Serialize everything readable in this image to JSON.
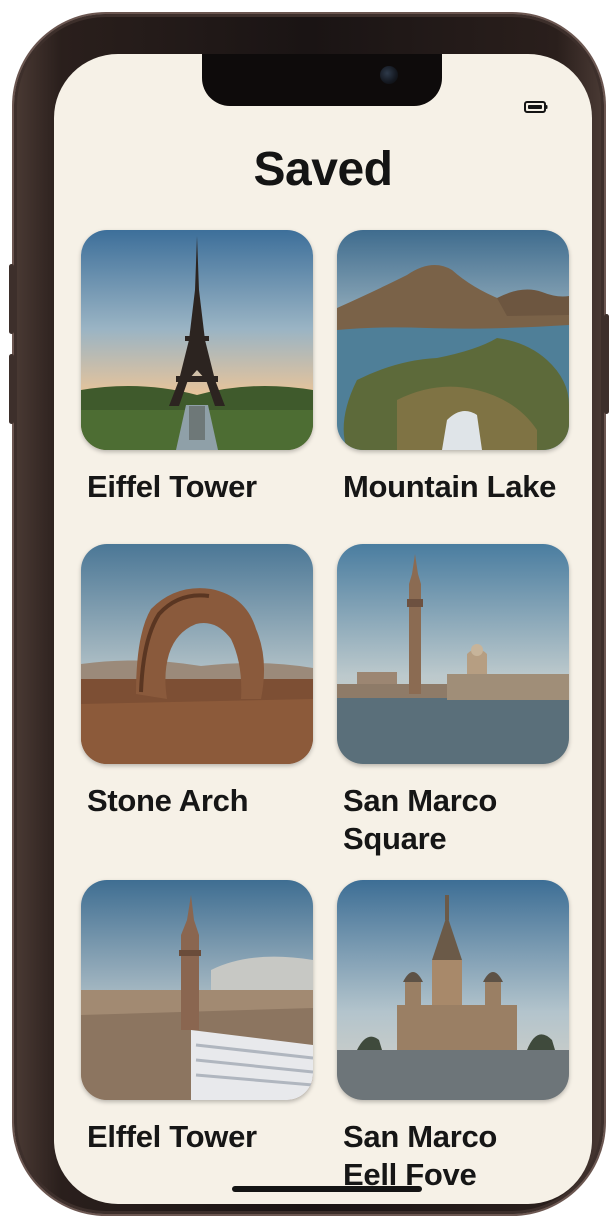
{
  "screen": {
    "title": "Saved"
  },
  "status_bar": {
    "icon": "battery-icon"
  },
  "saved_items": [
    {
      "label": "Eiffel Tower",
      "image": "eiffel-tower-photo"
    },
    {
      "label": "Mountain Lake",
      "image": "mountain-lake-photo"
    },
    {
      "label": "Stone Arch",
      "image": "stone-arch-photo"
    },
    {
      "label": "San Marco\nSquare",
      "image": "san-marco-square-photo"
    },
    {
      "label": "Elffel Tower",
      "image": "tower-city-photo"
    },
    {
      "label": "San Marco\nEell Fove",
      "image": "cathedral-photo"
    }
  ],
  "colors": {
    "background": "#f6f1e7",
    "frame": "#1a1414",
    "text": "#161616"
  }
}
